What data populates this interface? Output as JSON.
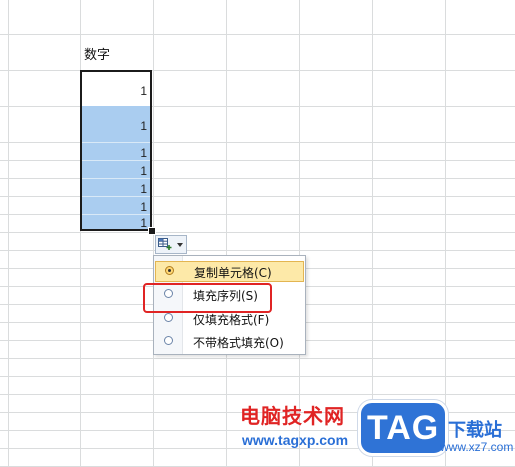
{
  "sheet": {
    "header_text": "数字",
    "values": [
      "1",
      "1",
      "1",
      "1",
      "1",
      "1",
      "1"
    ]
  },
  "autofill": {
    "icon": "autofill-options-icon"
  },
  "menu": {
    "items": [
      {
        "label": "复制单元格(C)",
        "checked": true
      },
      {
        "label": "填充序列(S)",
        "checked": false
      },
      {
        "label": "仅填充格式(F)",
        "checked": false
      },
      {
        "label": "不带格式填充(O)",
        "checked": false
      }
    ]
  },
  "colors": {
    "selection_fill": "#aacdf0",
    "highlight": "#e02424"
  },
  "watermark": {
    "brand_cn": "电脑技术网",
    "url": "www.tagxp.com",
    "logo": "TAG",
    "side_text": "下载站",
    "side_url": "www.xz7.com"
  }
}
